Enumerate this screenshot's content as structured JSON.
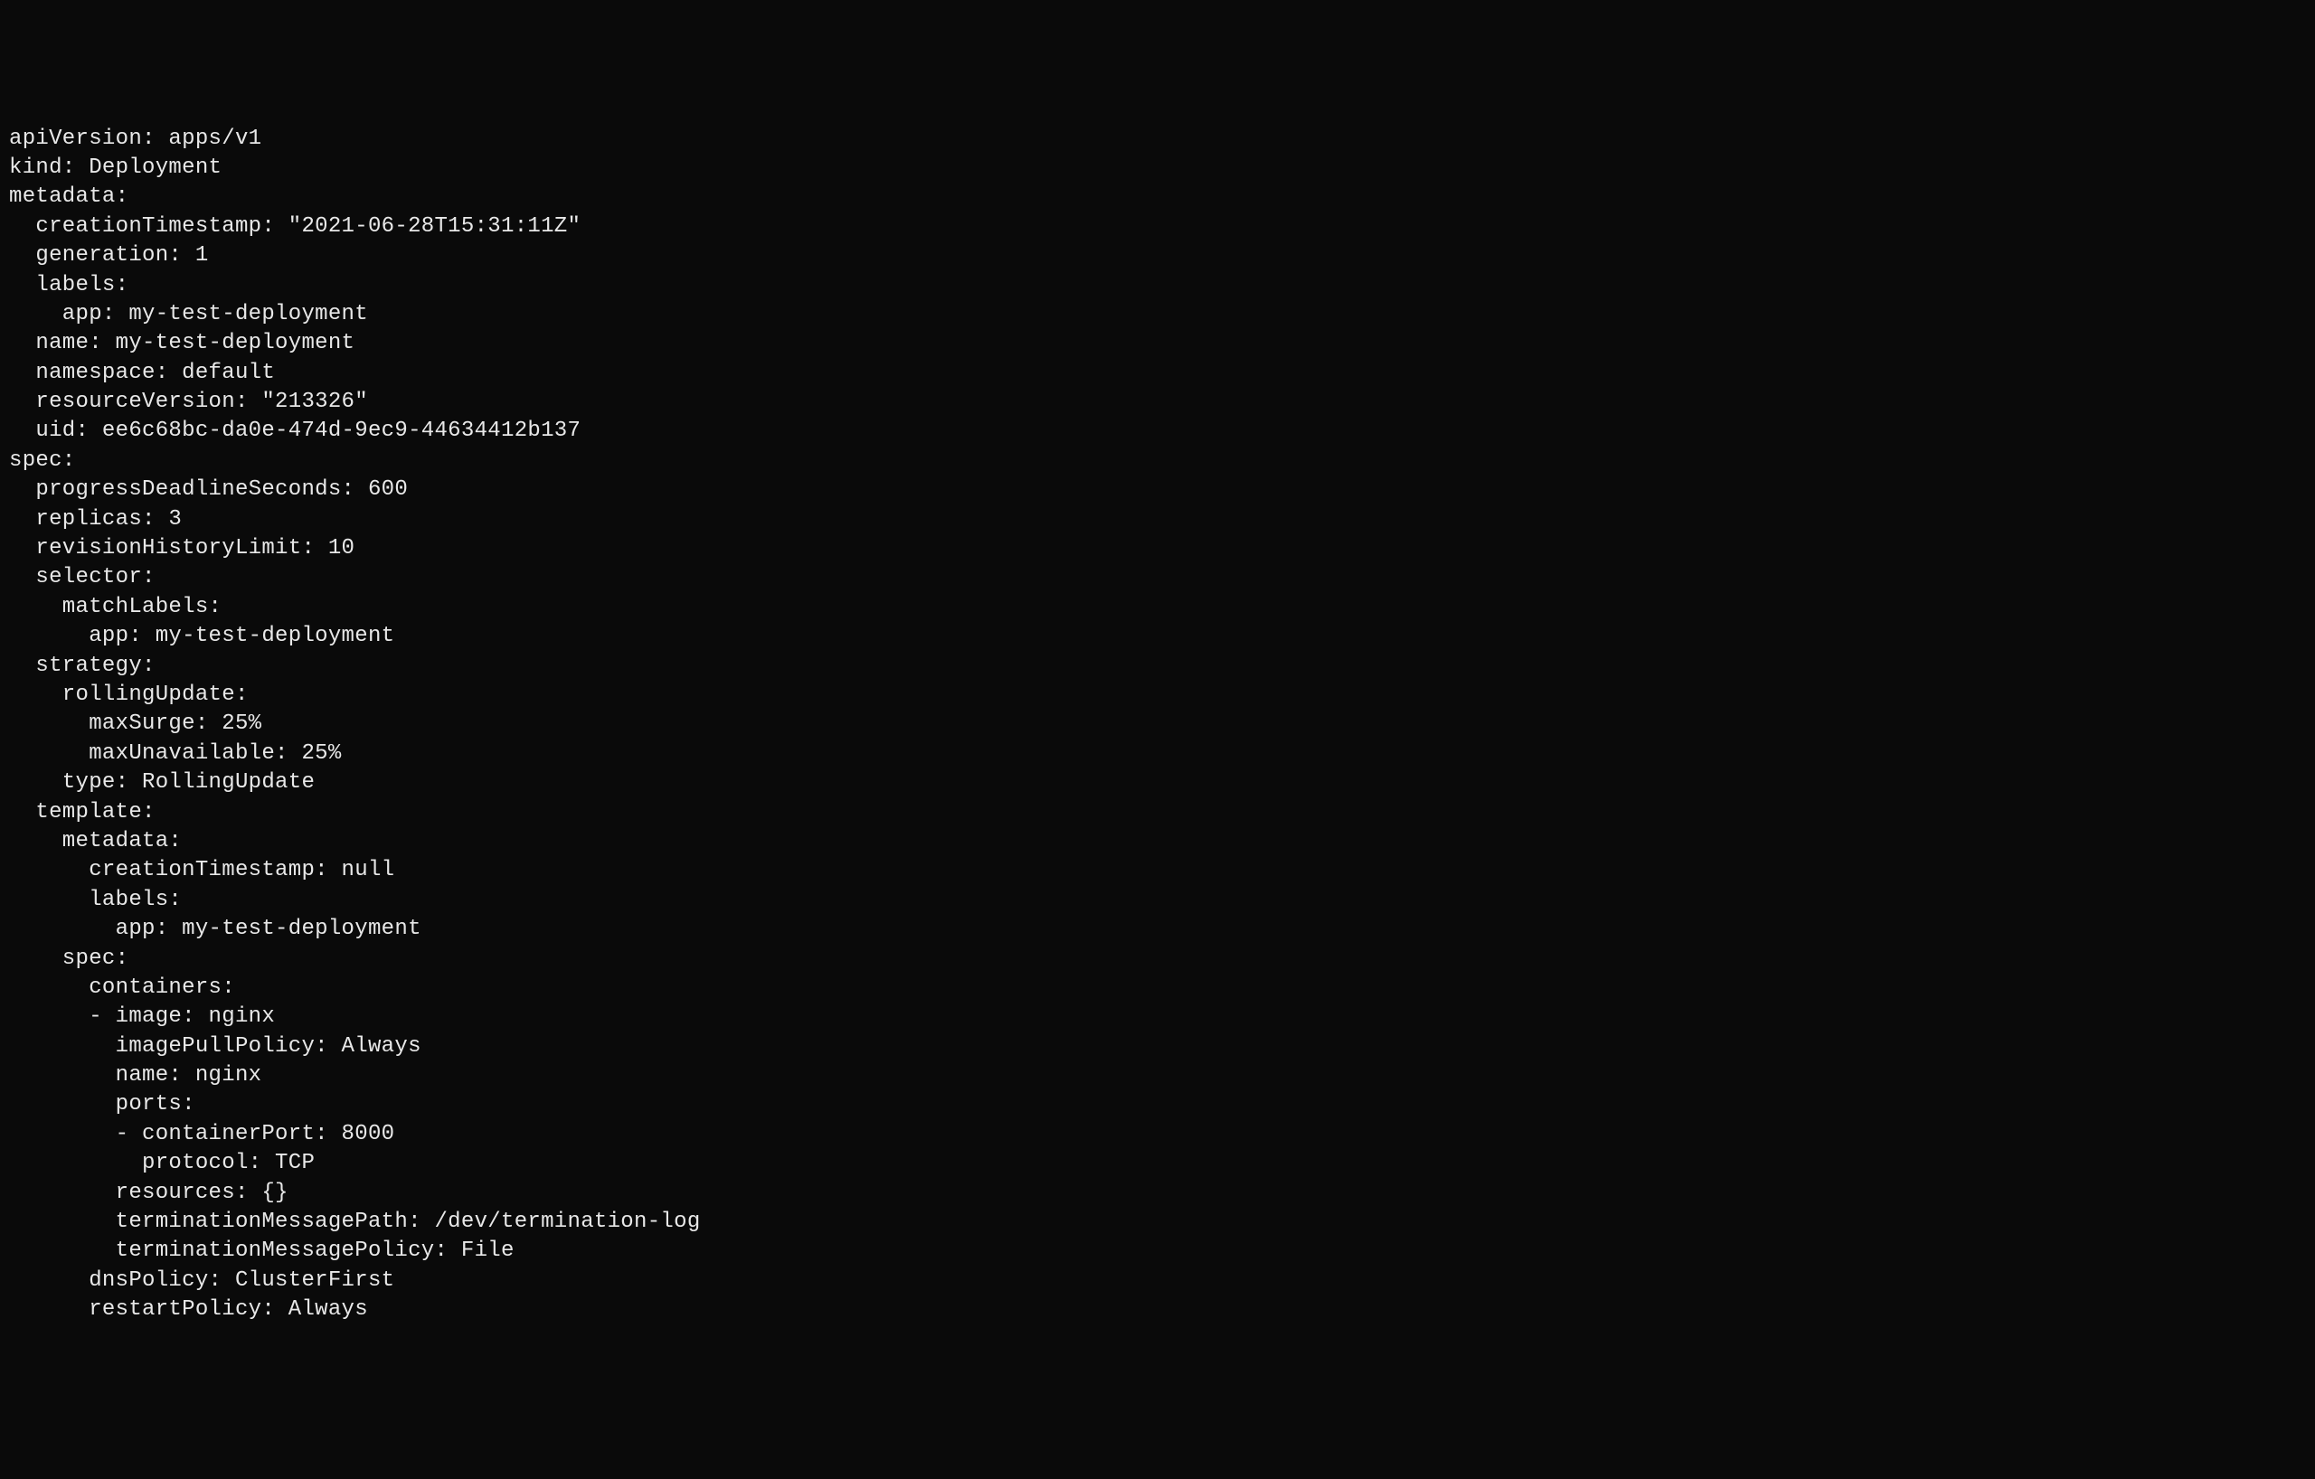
{
  "yaml": {
    "line1": "apiVersion: apps/v1",
    "line2": "kind: Deployment",
    "line3": "metadata:",
    "line4": "  creationTimestamp: \"2021-06-28T15:31:11Z\"",
    "line5": "  generation: 1",
    "line6": "  labels:",
    "line7": "    app: my-test-deployment",
    "line8": "  name: my-test-deployment",
    "line9": "  namespace: default",
    "line10": "  resourceVersion: \"213326\"",
    "line11": "  uid: ee6c68bc-da0e-474d-9ec9-44634412b137",
    "line12": "spec:",
    "line13": "  progressDeadlineSeconds: 600",
    "line14": "  replicas: 3",
    "line15": "  revisionHistoryLimit: 10",
    "line16": "  selector:",
    "line17": "    matchLabels:",
    "line18": "      app: my-test-deployment",
    "line19": "  strategy:",
    "line20": "    rollingUpdate:",
    "line21": "      maxSurge: 25%",
    "line22": "      maxUnavailable: 25%",
    "line23": "    type: RollingUpdate",
    "line24": "  template:",
    "line25": "    metadata:",
    "line26": "      creationTimestamp: null",
    "line27": "      labels:",
    "line28": "        app: my-test-deployment",
    "line29": "    spec:",
    "line30": "      containers:",
    "line31": "      - image: nginx",
    "line32": "        imagePullPolicy: Always",
    "line33": "        name: nginx",
    "line34": "        ports:",
    "line35": "        - containerPort: 8000",
    "line36": "          protocol: TCP",
    "line37": "        resources: {}",
    "line38": "        terminationMessagePath: /dev/termination-log",
    "line39": "        terminationMessagePolicy: File",
    "line40": "      dnsPolicy: ClusterFirst",
    "line41": "      restartPolicy: Always"
  }
}
